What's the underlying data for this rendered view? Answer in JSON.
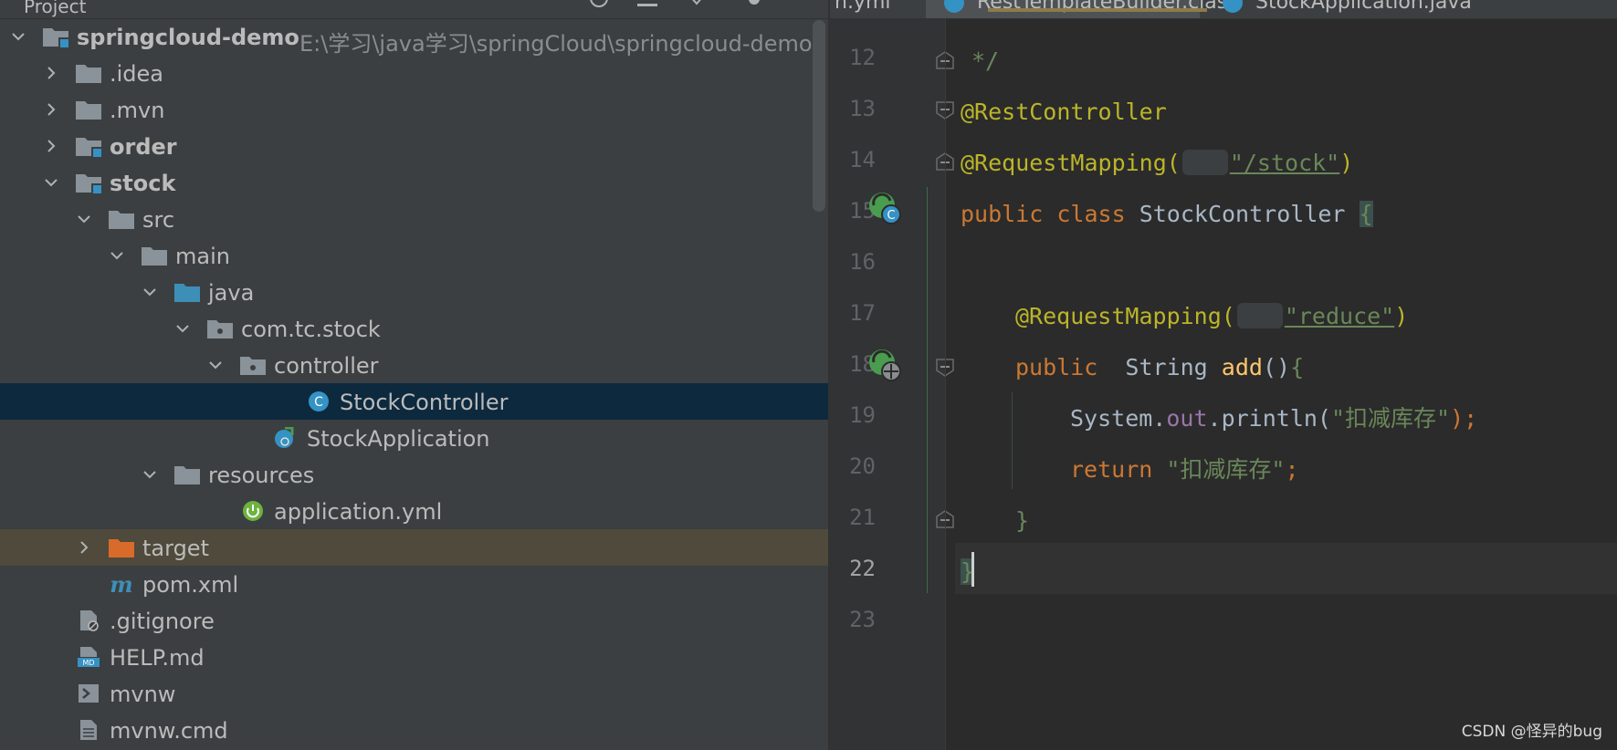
{
  "project_panel": {
    "header_title": "Project",
    "tree": [
      {
        "label": "springcloud-demo",
        "path": "E:\\学习\\java学习\\springCloud\\springcloud-demo",
        "icon": "module-folder-icon",
        "expanded": true
      },
      {
        "label": ".idea",
        "icon": "folder-icon",
        "expanded": false
      },
      {
        "label": ".mvn",
        "icon": "folder-icon",
        "expanded": false
      },
      {
        "label": "order",
        "icon": "module-folder-icon",
        "expanded": false
      },
      {
        "label": "stock",
        "icon": "module-folder-icon",
        "expanded": true
      },
      {
        "label": "src",
        "icon": "folder-icon",
        "expanded": true
      },
      {
        "label": "main",
        "icon": "folder-icon",
        "expanded": true
      },
      {
        "label": "java",
        "icon": "source-folder-icon",
        "expanded": true
      },
      {
        "label": "com.tc.stock",
        "icon": "package-icon",
        "expanded": true
      },
      {
        "label": "controller",
        "icon": "package-icon",
        "expanded": true
      },
      {
        "label": "StockController",
        "icon": "java-class-icon",
        "selected": true
      },
      {
        "label": "StockApplication",
        "icon": "spring-boot-class-icon"
      },
      {
        "label": "resources",
        "icon": "folder-icon",
        "expanded": true
      },
      {
        "label": "application.yml",
        "icon": "spring-config-icon"
      },
      {
        "label": "target",
        "icon": "excluded-folder-icon",
        "expanded": false
      },
      {
        "label": "pom.xml",
        "icon": "maven-icon"
      },
      {
        "label": ".gitignore",
        "icon": "gitignore-file-icon"
      },
      {
        "label": "HELP.md",
        "icon": "markdown-file-icon"
      },
      {
        "label": "mvnw",
        "icon": "shell-file-icon"
      },
      {
        "label": "mvnw.cmd",
        "icon": "text-file-icon"
      }
    ]
  },
  "editor": {
    "tabs": [
      {
        "label": "n.yml"
      },
      {
        "label": "RestTemplateBuilder.class"
      },
      {
        "label": "StockApplication.java"
      }
    ],
    "line_numbers": [
      "12",
      "13",
      "14",
      "15",
      "16",
      "17",
      "18",
      "19",
      "20",
      "21",
      "22",
      "23"
    ],
    "current_line": "22",
    "code": {
      "l12": "*/",
      "l13": "@RestController",
      "l14_annotation": "@RequestMapping(",
      "l14_value": "\"/stock\"",
      "l14_close": ")",
      "l15_public": "public",
      "l15_class": "class",
      "l15_name": "StockController",
      "l15_brace": "{",
      "l17_annotation": "@RequestMapping(",
      "l17_value": "\"reduce\"",
      "l17_close": ")",
      "l18_public": "public",
      "l18_type": "String",
      "l18_method": "add",
      "l18_parens": "()",
      "l18_brace": "{",
      "l19_system": "System.",
      "l19_out": "out",
      "l19_println": ".println(",
      "l19_string": "\"扣减库存\"",
      "l19_end": ");",
      "l20_return": "return",
      "l20_string": "\"扣减库存\"",
      "l20_end": ";",
      "l21": "}",
      "l22": "}"
    }
  },
  "watermark": "CSDN @怪异的bug",
  "colors": {
    "keyword": "#cc7832",
    "annotation": "#bbb529",
    "string": "#6a8759",
    "selection": "#0d293e"
  }
}
